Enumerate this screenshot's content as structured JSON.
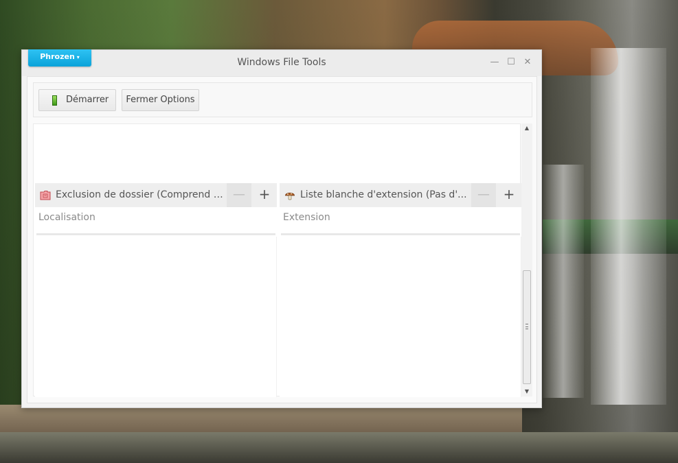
{
  "window": {
    "title": "Windows File Tools",
    "brand_menu": {
      "label": "Phrozen",
      "caret": "▾"
    },
    "controls": {
      "minimize": "—",
      "maximize": "☐",
      "close": "✕"
    }
  },
  "toolbar": {
    "start_label": "Démarrer",
    "start_icon": "battery-icon",
    "close_options_label": "Fermer Options"
  },
  "panels": {
    "folder_exclusion": {
      "title": "Exclusion de dossier (Comprend t...",
      "icon": "folder-icon",
      "remove": "—",
      "add": "+",
      "column_header": "Localisation"
    },
    "extension_whitelist": {
      "title": "Liste blanche d'extension (Pas d'...",
      "icon": "mushroom-icon",
      "remove": "—",
      "add": "+",
      "column_header": "Extension"
    }
  },
  "scrollbar": {
    "up": "▲",
    "down": "▼"
  }
}
